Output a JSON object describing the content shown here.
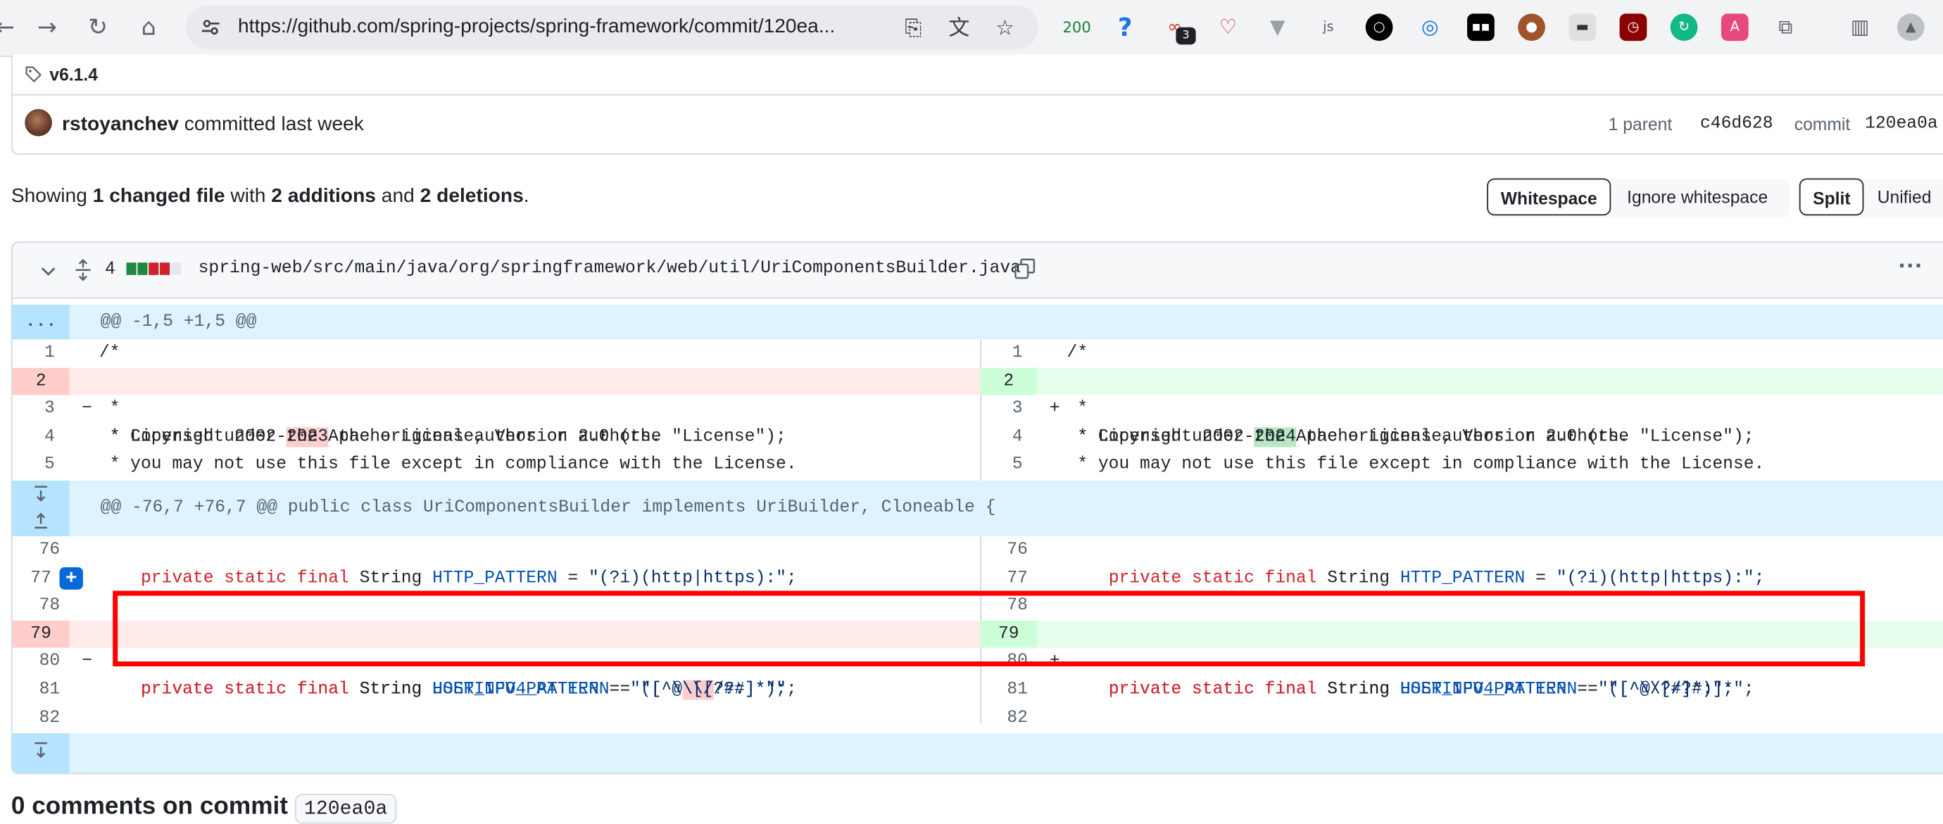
{
  "browser": {
    "url": "https://github.com/spring-projects/spring-framework/commit/120ea...",
    "extension_badge_count": "200",
    "extension_notification_count": "3"
  },
  "commit": {
    "tag": "v6.1.4",
    "author": "rstoyanchev",
    "committed_text": "committed last week",
    "parent_label": "1 parent",
    "parent_sha": "c46d628",
    "commit_label": "commit",
    "commit_sha": "120ea0a"
  },
  "summary": {
    "showing": "Showing",
    "changed": "1 changed file",
    "with": "with",
    "additions": "2 additions",
    "and": "and",
    "deletions": "2 deletions",
    "period": "."
  },
  "controls": {
    "whitespace": "Whitespace",
    "ignore_whitespace": "Ignore whitespace",
    "split": "Split",
    "unified": "Unified"
  },
  "file": {
    "changes": "4",
    "path": "spring-web/src/main/java/org/springframework/web/util/UriComponentsBuilder.java",
    "more": "···"
  },
  "diff": {
    "expander_dots": "...",
    "hunk1": "@@ -1,5 +1,5 @@",
    "hunk2": "@@ -76,7 +76,7 @@ public class UriComponentsBuilder implements UriBuilder, Cloneable {",
    "left": {
      "l1": {
        "num": "1",
        "code": "/*"
      },
      "l2": {
        "num": "2",
        "sign": "−",
        "pre": " * Copyright 2002-",
        "em": "2023",
        "post": " the original author or authors."
      },
      "l3": {
        "num": "3",
        "code": " *"
      },
      "l4": {
        "num": "4",
        "code": " * Licensed under the Apache License, Version 2.0 (the \"License\");"
      },
      "l5": {
        "num": "5",
        "code": " * you may not use this file except in compliance with the License."
      },
      "l76": {
        "num": "76"
      },
      "l77": {
        "num": "77",
        "ident": "HTTP_PATTERN",
        "str": "\"(?i)(http|https):\";"
      },
      "l78": {
        "num": "78"
      },
      "l79": {
        "num": "79",
        "sign": "−",
        "ident": "USERINFO_PATTERN",
        "str_pre": "\"([^@",
        "str_em": "\\\\[",
        "str_post": "/?#]*)\";"
      },
      "l80": {
        "num": "80"
      },
      "l81": {
        "num": "81",
        "ident": "HOST_IPV4_PATTERN",
        "str": "\"[^\\\\[/?#:]*\";"
      },
      "l82": {
        "num": "82"
      }
    },
    "right": {
      "l1": {
        "num": "1",
        "code": "/*"
      },
      "l2": {
        "num": "2",
        "sign": "+",
        "pre": " * Copyright 2002-",
        "em": "2024",
        "post": " the original author or authors."
      },
      "l3": {
        "num": "3",
        "code": " *"
      },
      "l4": {
        "num": "4",
        "code": " * Licensed under the Apache License, Version 2.0 (the \"License\");"
      },
      "l5": {
        "num": "5",
        "code": " * you may not use this file except in compliance with the License."
      },
      "l76": {
        "num": "76"
      },
      "l77": {
        "num": "77",
        "ident": "HTTP_PATTERN",
        "str": "\"(?i)(http|https):\";"
      },
      "l78": {
        "num": "78"
      },
      "l79": {
        "num": "79",
        "sign": "+",
        "ident": "USERINFO_PATTERN",
        "str": "\"([^@/?#]*)\";"
      },
      "l80": {
        "num": "80"
      },
      "l81": {
        "num": "81",
        "ident": "HOST_IPV4_PATTERN",
        "str": "\"[^\\\\[/?#:]*\";"
      },
      "l82": {
        "num": "82"
      }
    },
    "kw": {
      "private": "private",
      "static": "static",
      "final": "final",
      "type": "String",
      "eq": " = "
    }
  },
  "comments": {
    "heading": "0 comments on commit",
    "sha": "120ea0a"
  },
  "colors": {
    "deletion_bg": "#ffebe9",
    "addition_bg": "#e6ffec",
    "hunk_bg": "#ddf4ff",
    "annotation_box": "#ff0000"
  }
}
